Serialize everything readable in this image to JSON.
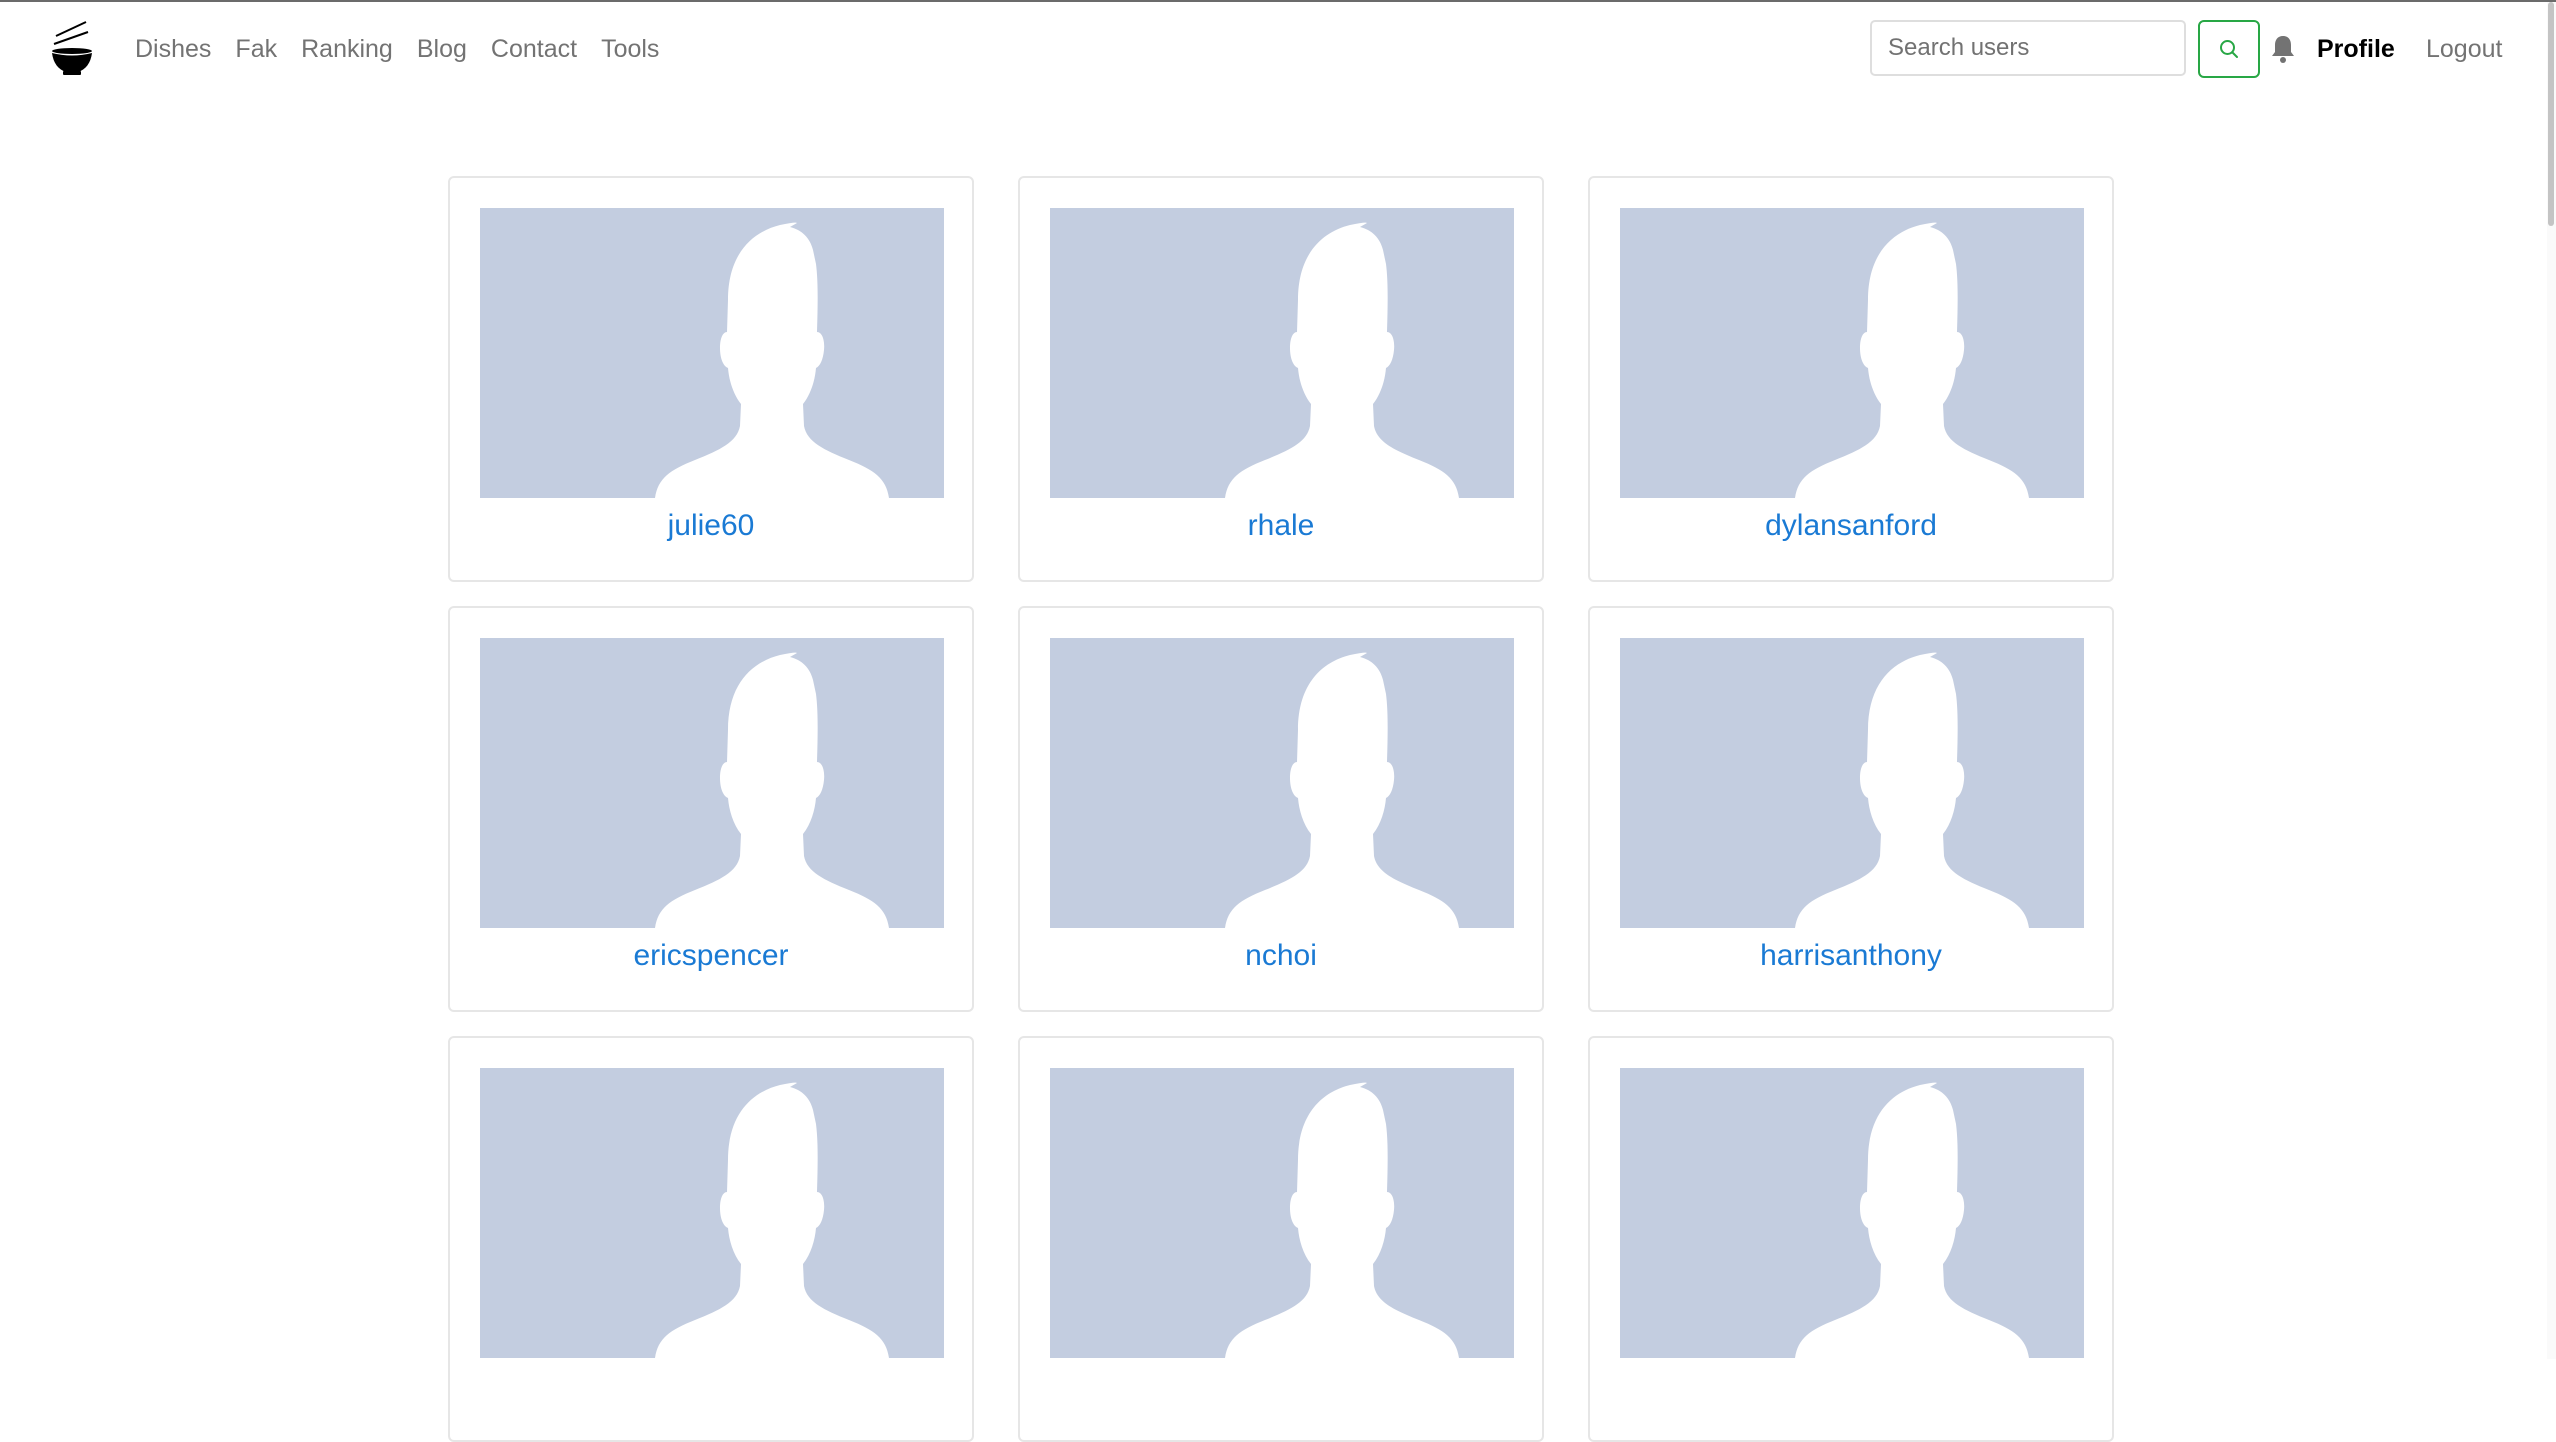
{
  "app": {
    "logo_icon": "noodle-bowl-icon"
  },
  "nav": {
    "links": [
      "Dishes",
      "Fak",
      "Ranking",
      "Blog",
      "Contact",
      "Tools"
    ],
    "search": {
      "placeholder": "Search users",
      "value": "",
      "button_icon": "search-icon",
      "button_color": "#28a745"
    },
    "notification_icon": "bell-icon",
    "profile_label": "Profile",
    "logout_label": "Logout"
  },
  "users": [
    {
      "username": "julie60"
    },
    {
      "username": "rhale"
    },
    {
      "username": "dylansanford"
    },
    {
      "username": "ericspencer"
    },
    {
      "username": "nchoi"
    },
    {
      "username": "harrisanthony"
    },
    {
      "username": ""
    },
    {
      "username": ""
    },
    {
      "username": ""
    }
  ],
  "colors": {
    "username_link": "#1a7ad4",
    "avatar_placeholder_bg": "#c3cde0",
    "avatar_silhouette": "#ffffff"
  }
}
